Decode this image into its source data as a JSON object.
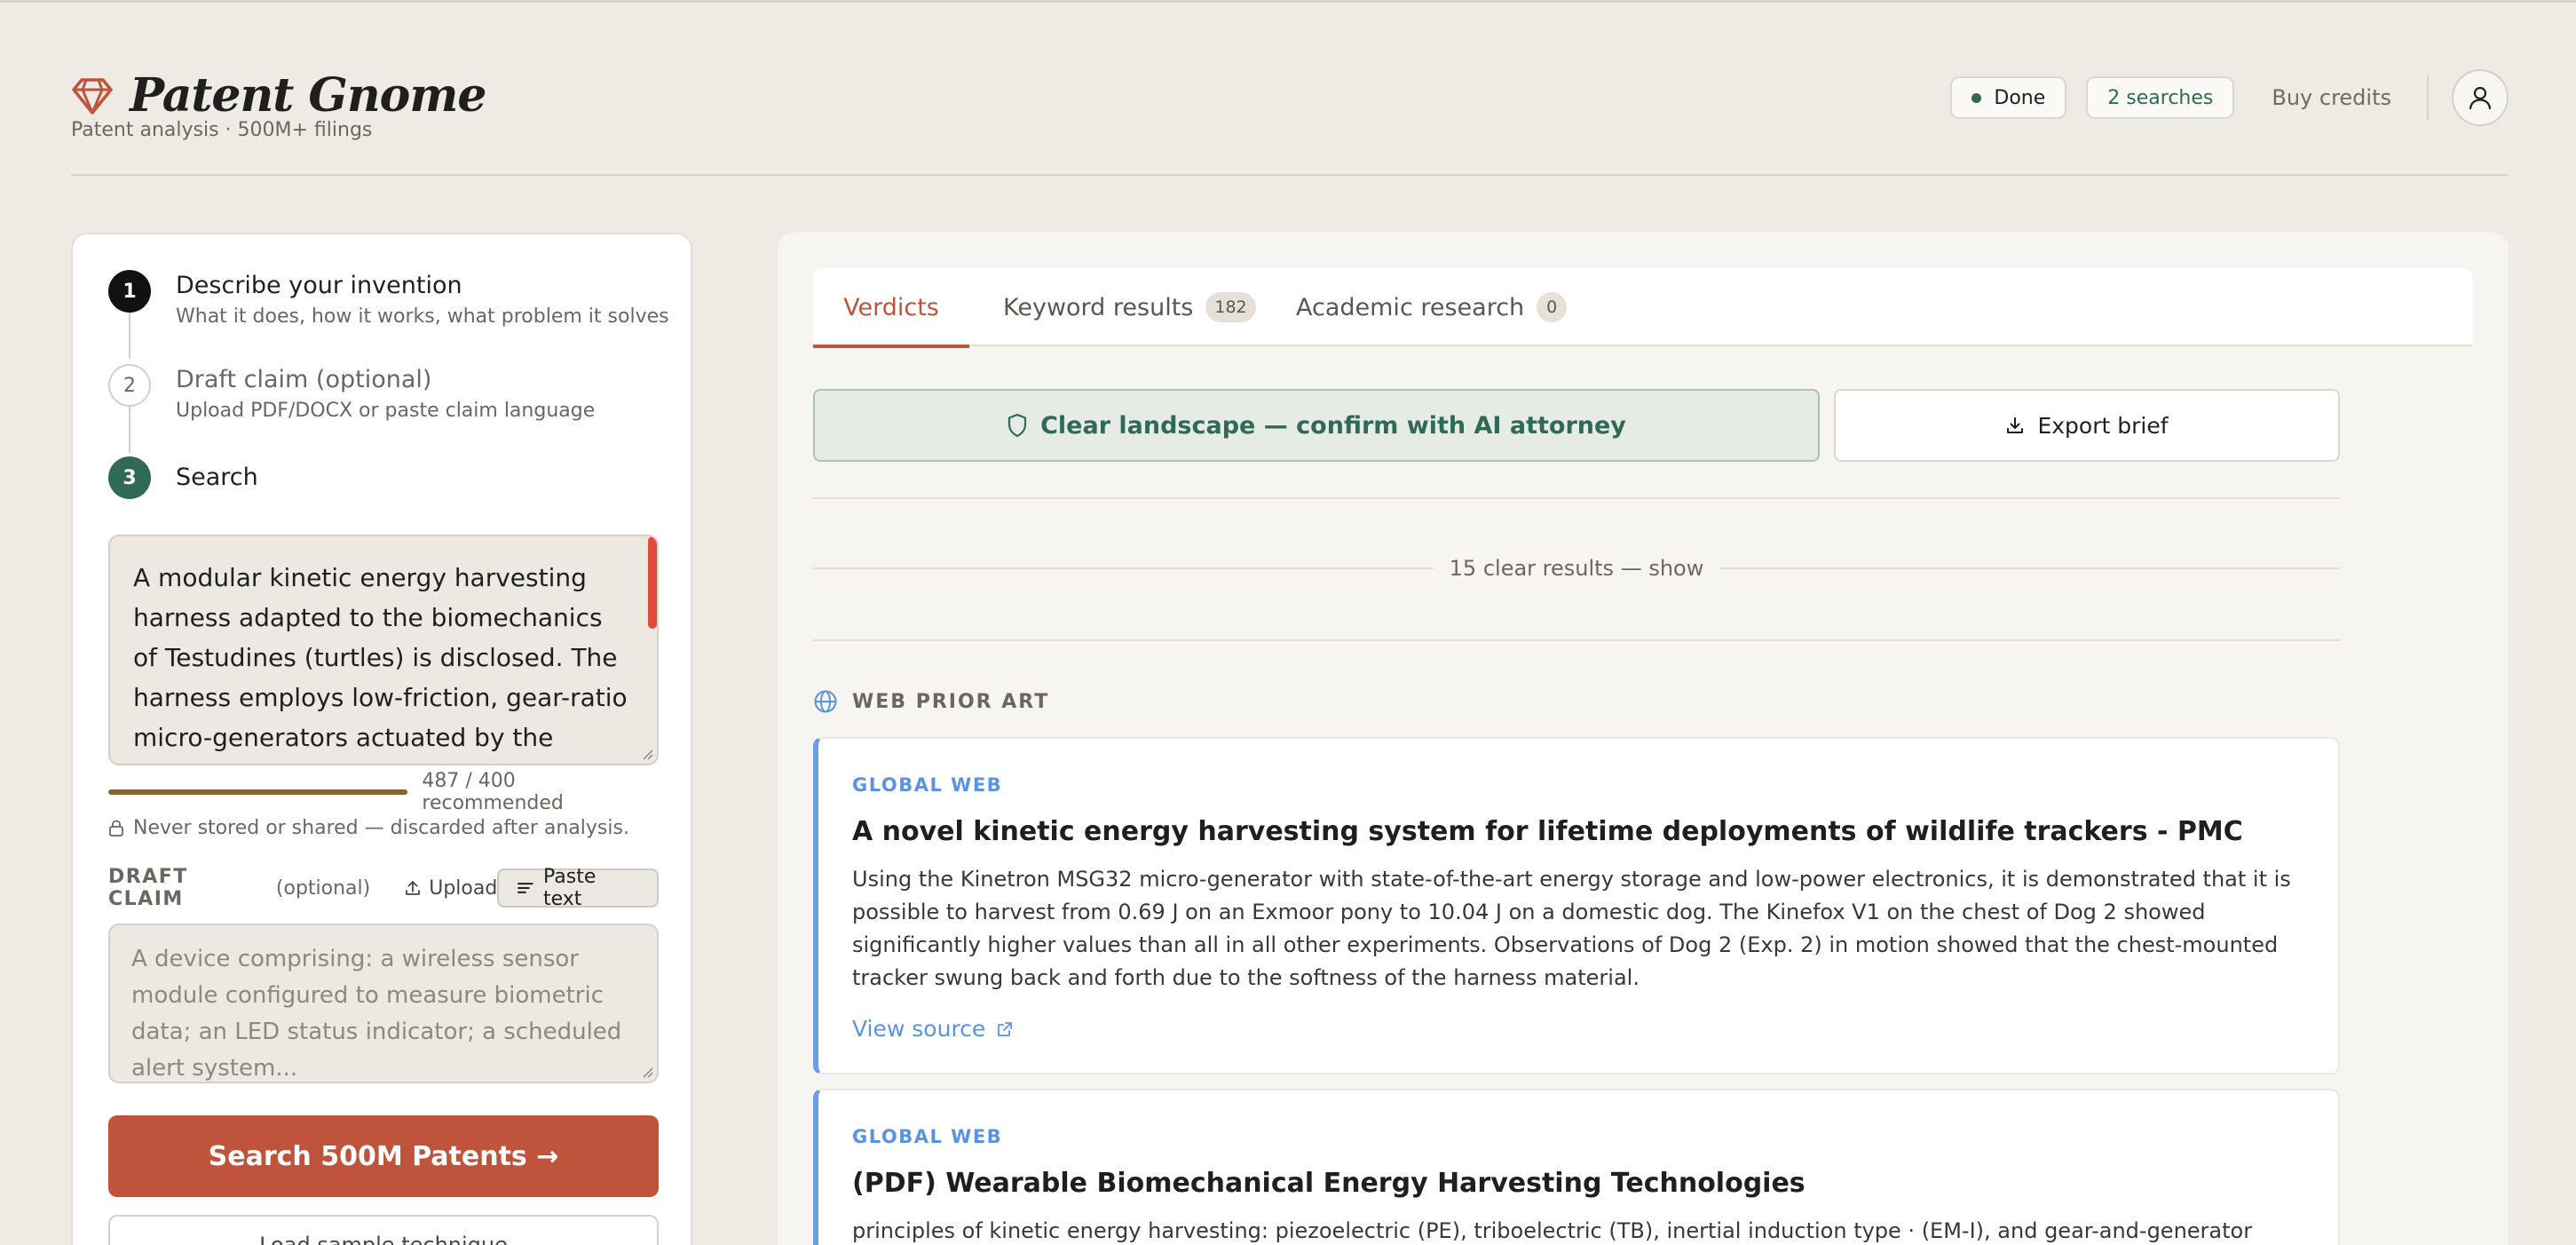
{
  "app": {
    "title": "Patent Gnome",
    "subtitle": "Patent analysis · 500M+ filings"
  },
  "header": {
    "status_label": "Done",
    "searches_label": "2 searches",
    "buy_credits_label": "Buy credits"
  },
  "colors": {
    "accent": "#bf533b",
    "success_green": "#2f6a55",
    "link_blue": "#5b93e3",
    "background": "#efebe4"
  },
  "steps": [
    {
      "number": "1",
      "title": "Describe your invention",
      "description": "What it does, how it works, what problem it solves"
    },
    {
      "number": "2",
      "title": "Draft claim (optional)",
      "description": "Upload PDF/DOCX or paste claim language"
    },
    {
      "number": "3",
      "title": "Search"
    }
  ],
  "description_input": {
    "value": "A modular kinetic energy harvesting harness adapted to the biomechanics of Testudines (turtles) is disclosed. The harness employs low-friction, gear-ratio micro-generators actuated by the",
    "char_count": "487 / 400 recommended"
  },
  "privacy_note": "Never stored or shared — discarded after analysis.",
  "draft_claim": {
    "label": "DRAFT CLAIM",
    "optional": "(optional)",
    "upload_label": "Upload",
    "paste_label": "Paste text",
    "placeholder": "A device comprising: a wireless sensor module configured to measure biometric data; an LED status indicator; a scheduled alert system..."
  },
  "search_button": "Search 500M Patents →",
  "sample_button": "Load sample technique",
  "tabs": [
    {
      "label": "Verdicts"
    },
    {
      "label": "Keyword results",
      "count": "182"
    },
    {
      "label": "Academic research",
      "count": "0"
    }
  ],
  "verdict_banner": "Clear landscape — confirm with AI attorney",
  "export_button": "Export brief",
  "clear_results_toggle": "15 clear results — show",
  "web_prior_art": {
    "header": "WEB PRIOR ART",
    "cards": [
      {
        "tag": "GLOBAL WEB",
        "title": "A novel kinetic energy harvesting system for lifetime deployments of wildlife trackers - PMC",
        "body": "Using the Kinetron MSG32 micro-generator with state-of-the-art energy storage and low-power electronics, it is demonstrated that it is possible to harvest from 0.69 J on an Exmoor pony to 10.04 J on a domestic dog. The Kinefox V1 on the chest of Dog 2 showed significantly higher values than all in all other experiments. Observations of Dog 2 (Exp. 2) in motion showed that the chest-mounted tracker swung back and forth due to the softness of the harness material.",
        "link_label": "View source"
      },
      {
        "tag": "GLOBAL WEB",
        "title": "(PDF) Wearable Biomechanical Energy Harvesting Technologies",
        "body": "principles of kinetic energy harvesting: piezoelectric (PE), triboelectric (TB), inertial induction type · (EM-I), and gear-and-generator type (EM-G) of"
      }
    ]
  }
}
